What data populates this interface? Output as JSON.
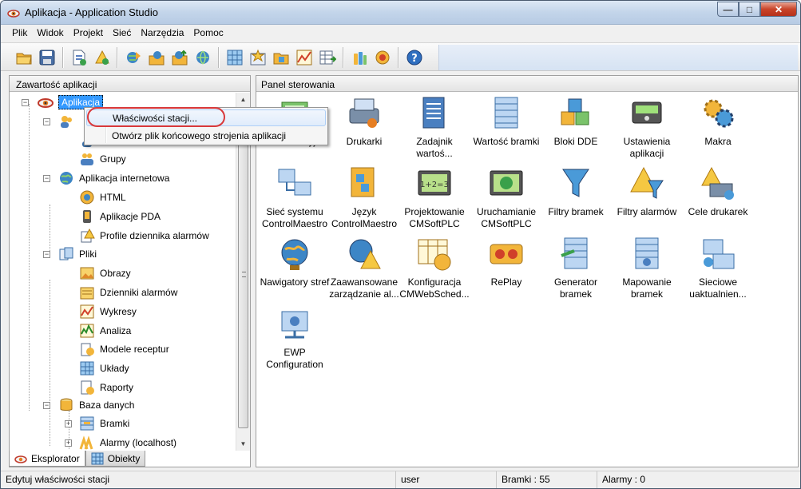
{
  "window": {
    "title": "Aplikacja - Application Studio",
    "controls": [
      "minimize",
      "maximize",
      "close"
    ]
  },
  "menu": [
    "Plik",
    "Widok",
    "Projekt",
    "Sieć",
    "Narzędzia",
    "Pomoc"
  ],
  "toolbar": {
    "buttons": [
      "open-folder",
      "save",
      "new-document",
      "alarm-document",
      "station-sync",
      "station-transfer",
      "station-upload",
      "station-globe",
      "grid-layout",
      "chart-star",
      "folder-puzzle",
      "trend-chart",
      "table-export",
      "bottles",
      "globe-run",
      "help"
    ]
  },
  "left_pane": {
    "title": "Zawartość aplikacji",
    "tree": [
      {
        "label": "Aplikacja",
        "selected": true,
        "expanded": true,
        "icon": "app-eye-icon"
      },
      {
        "label": "",
        "icon": "users-icon",
        "partial": true
      },
      {
        "label": "",
        "icon": "user-icon",
        "partial": true
      },
      {
        "label": "Grupy",
        "icon": "group-icon"
      },
      {
        "label": "Aplikacja internetowa",
        "icon": "globe-icon",
        "expanded": true
      },
      {
        "label": "HTML",
        "icon": "html-icon"
      },
      {
        "label": "Aplikacje PDA",
        "icon": "pda-icon"
      },
      {
        "label": "Profile dziennika alarmów",
        "icon": "alarm-profile-icon"
      },
      {
        "label": "Pliki",
        "icon": "files-icon",
        "expanded": true
      },
      {
        "label": "Obrazy",
        "icon": "images-icon"
      },
      {
        "label": "Dzienniki alarmów",
        "icon": "alarm-log-icon"
      },
      {
        "label": "Wykresy",
        "icon": "chart-icon"
      },
      {
        "label": "Analiza",
        "icon": "analysis-icon"
      },
      {
        "label": "Modele receptur",
        "icon": "recipe-icon"
      },
      {
        "label": "Układy",
        "icon": "layout-icon"
      },
      {
        "label": "Raporty",
        "icon": "report-icon"
      },
      {
        "label": "Baza danych",
        "icon": "database-icon",
        "expanded": true
      },
      {
        "label": "Bramki",
        "icon": "gateways-icon"
      },
      {
        "label": "Alarmy (localhost)",
        "icon": "alarms-icon"
      }
    ]
  },
  "tabs": [
    {
      "label": "Eksplorator",
      "active": true
    },
    {
      "label": "Obiekty",
      "active": false
    }
  ],
  "right_pane": {
    "title": "Panel sterowania",
    "tiles": [
      {
        "label": "komunikacyjne",
        "icon": "comm-icon"
      },
      {
        "label": "Drukarki",
        "icon": "printer-icon"
      },
      {
        "label": "Zadajnik wartoś...",
        "icon": "value-setter-icon"
      },
      {
        "label": "Wartość bramki",
        "icon": "gateway-value-icon"
      },
      {
        "label": "Bloki DDE",
        "icon": "dde-blocks-icon"
      },
      {
        "label": "Ustawienia aplikacji",
        "icon": "app-settings-icon"
      },
      {
        "label": "Makra",
        "icon": "macros-icon"
      },
      {
        "label": "Sieć systemu ControlMaestro",
        "icon": "system-network-icon"
      },
      {
        "label": "Język ControlMaestro",
        "icon": "language-icon"
      },
      {
        "label": "Projektowanie CMSoftPLC",
        "icon": "plc-design-icon"
      },
      {
        "label": "Uruchamianie CMSoftPLC",
        "icon": "plc-run-icon"
      },
      {
        "label": "Filtry bramek",
        "icon": "gateway-filter-icon"
      },
      {
        "label": "Filtry alarmów",
        "icon": "alarm-filter-icon"
      },
      {
        "label": "Cele drukarek",
        "icon": "printer-targets-icon"
      },
      {
        "label": "Nawigatory stref",
        "icon": "zone-navigator-icon"
      },
      {
        "label": "Zaawansowane zarządzanie al...",
        "icon": "advanced-alarm-icon"
      },
      {
        "label": "Konfiguracja CMWebSched...",
        "icon": "websched-config-icon"
      },
      {
        "label": "RePlay",
        "icon": "replay-icon"
      },
      {
        "label": "Generator bramek",
        "icon": "gateway-generator-icon"
      },
      {
        "label": "Mapowanie bramek",
        "icon": "gateway-mapping-icon"
      },
      {
        "label": "Sieciowe uaktualnien...",
        "icon": "network-update-icon"
      },
      {
        "label": "EWP Configuration",
        "icon": "ewp-config-icon"
      }
    ]
  },
  "context_menu": {
    "items": [
      "Właściwości stacji...",
      "Otwórz plik końcowego strojenia aplikacji"
    ],
    "hovered": 0
  },
  "statusbar": {
    "message": "Edytuj właściwości stacji",
    "user": "user",
    "gateways": "Bramki : 55",
    "alarms": "Alarmy : 0"
  },
  "colors": {
    "selection": "#3399ff",
    "highlight_ring": "#d9383a",
    "title_bar": "#c3d5ea",
    "close_button": "#c9442a"
  }
}
